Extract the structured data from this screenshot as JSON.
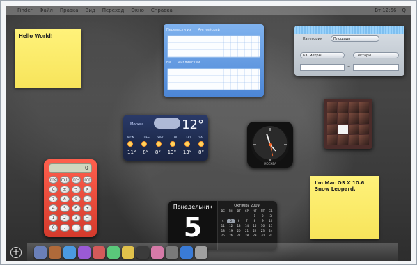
{
  "menubar": {
    "items": [
      "Finder",
      "Файл",
      "Правка",
      "Вид",
      "Переход",
      "Окно",
      "Справка"
    ],
    "right": [
      "Вт 12:56",
      "Q"
    ]
  },
  "sticky_notes": [
    {
      "text": "Hello World!"
    },
    {
      "text": "I'm Mac OS X 10.6 Snow Leopard."
    }
  ],
  "translation": {
    "row1_from": "Перевести из",
    "row1_lang": "Английский",
    "row2_to": "На",
    "row2_lang": "Английский"
  },
  "converter": {
    "category_label": "Категория",
    "category_value": "Площадь",
    "from_unit": "Кв. метры",
    "to_unit": "Гектары",
    "equals": "="
  },
  "weather": {
    "city": "Москва",
    "temperature": "12°",
    "days": [
      "MON",
      "TUES",
      "WED",
      "THU",
      "FRI",
      "SAT"
    ],
    "temps": [
      "11°",
      "8°",
      "8°",
      "13°",
      "13°",
      "8°"
    ]
  },
  "clock": {
    "city": "МОСКВА"
  },
  "calculator": {
    "display": "0",
    "keys": [
      "mc",
      "m+",
      "m-",
      "mr",
      "C",
      "±",
      "÷",
      "×",
      "7",
      "8",
      "9",
      "-",
      "4",
      "5",
      "6",
      "+",
      "1",
      "2",
      "3",
      "=",
      "0",
      ".",
      "",
      ""
    ]
  },
  "calendar": {
    "day_name": "Понедельник",
    "day_number": "5",
    "month_label": "Октябрь 2009",
    "weekdays": [
      "ВС",
      "ПН",
      "ВТ",
      "СР",
      "ЧТ",
      "ПТ",
      "СБ"
    ],
    "days": [
      "",
      "",
      "",
      "",
      "1",
      "2",
      "3",
      "4",
      "5",
      "6",
      "7",
      "8",
      "9",
      "10",
      "11",
      "12",
      "13",
      "14",
      "15",
      "16",
      "17",
      "18",
      "19",
      "20",
      "21",
      "22",
      "23",
      "24",
      "25",
      "26",
      "27",
      "28",
      "29",
      "30",
      "31"
    ]
  },
  "dock": {
    "add_label": "+"
  },
  "colors": {
    "sticky_yellow": "#f7e45b",
    "calc_red": "#d43a2c",
    "weather_blue": "#1e2b4e",
    "translation_blue": "#4c86d6"
  }
}
